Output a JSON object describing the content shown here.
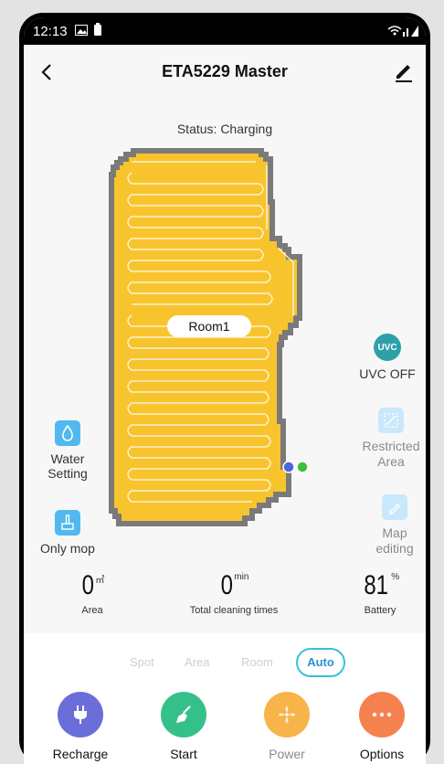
{
  "statusbar": {
    "time": "12:13"
  },
  "header": {
    "title": "ETA5229 Master"
  },
  "status_text": "Status: Charging",
  "map": {
    "room_label": "Room1"
  },
  "side_left": {
    "water": "Water Setting",
    "mop": "Only mop"
  },
  "side_right": {
    "uvc": "UVC OFF",
    "uvc_icon": "UVC",
    "restricted": "Restricted Area",
    "map_edit": "Map editing"
  },
  "stats": {
    "area": {
      "value": "0",
      "unit": "㎡",
      "label": "Area"
    },
    "time": {
      "value": "0",
      "unit": "min",
      "label": "Total cleaning times"
    },
    "battery": {
      "value": "81",
      "unit": "%",
      "label": "Battery"
    }
  },
  "modes": {
    "spot": "Spot",
    "area": "Area",
    "room": "Room",
    "auto": "Auto"
  },
  "actions": {
    "recharge": "Recharge",
    "start": "Start",
    "power": "Power",
    "options": "Options"
  },
  "colors": {
    "map_fill": "#f8c42e",
    "map_border": "#7a7a7a",
    "accent": "#34c2d9",
    "recharge": "#6b6ed8",
    "start": "#35c08a",
    "power": "#f6b449",
    "options": "#f5814f"
  }
}
